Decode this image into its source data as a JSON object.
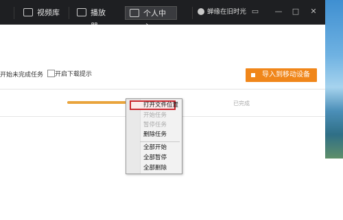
{
  "titlebar": {
    "tabs": [
      {
        "label": "视频库"
      },
      {
        "label": "播放器"
      },
      {
        "label": "个人中心"
      }
    ],
    "user_name": "蝉缘在旧时光"
  },
  "options": {
    "auto_start_label": "开始未完成任务",
    "download_tip_label": "开启下载提示"
  },
  "import_button": {
    "label": "导入到移动设备"
  },
  "task": {
    "status": "已完成",
    "progress": 0.86
  },
  "context_menu": {
    "items": [
      {
        "label": "打开文件位置"
      },
      {
        "label": "开始任务"
      },
      {
        "label": "暂停任务"
      },
      {
        "label": "删除任务"
      },
      {
        "label": "全部开始"
      },
      {
        "label": "全部暂停"
      },
      {
        "label": "全部删除"
      }
    ]
  },
  "colors": {
    "accent_orange": "#f0861a",
    "highlight_red": "#c9252c",
    "titlebar": "#1e1f22"
  }
}
